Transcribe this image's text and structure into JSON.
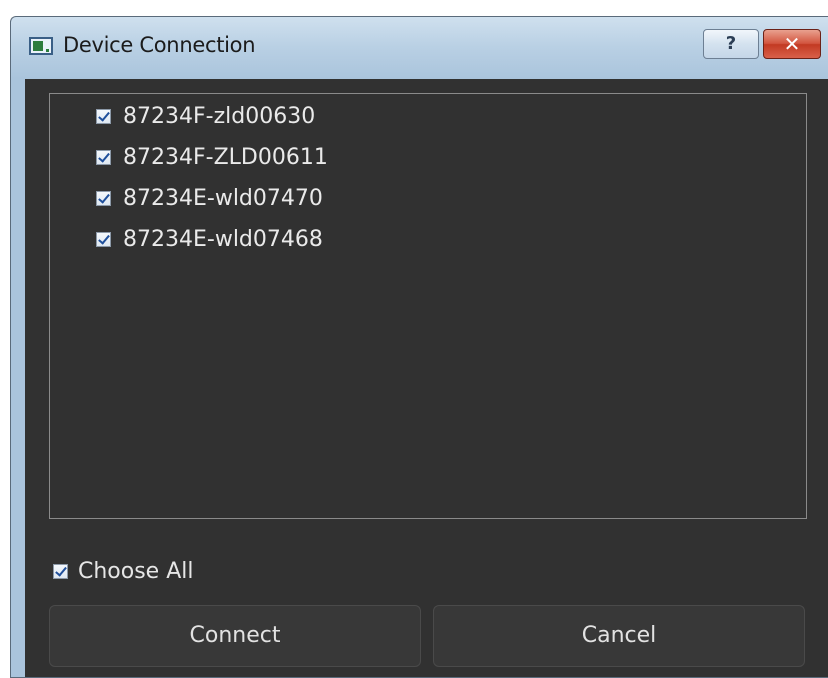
{
  "window": {
    "title": "Device Connection",
    "help_label": "?",
    "close_label": "✕"
  },
  "device_list": {
    "items": [
      {
        "label": "87234F-zld00630",
        "checked": true
      },
      {
        "label": "87234F-ZLD00611",
        "checked": true
      },
      {
        "label": "87234E-wld07470",
        "checked": true
      },
      {
        "label": "87234E-wld07468",
        "checked": true
      }
    ]
  },
  "choose_all": {
    "label": "Choose All",
    "checked": true
  },
  "buttons": {
    "connect_label": "Connect",
    "cancel_label": "Cancel"
  }
}
